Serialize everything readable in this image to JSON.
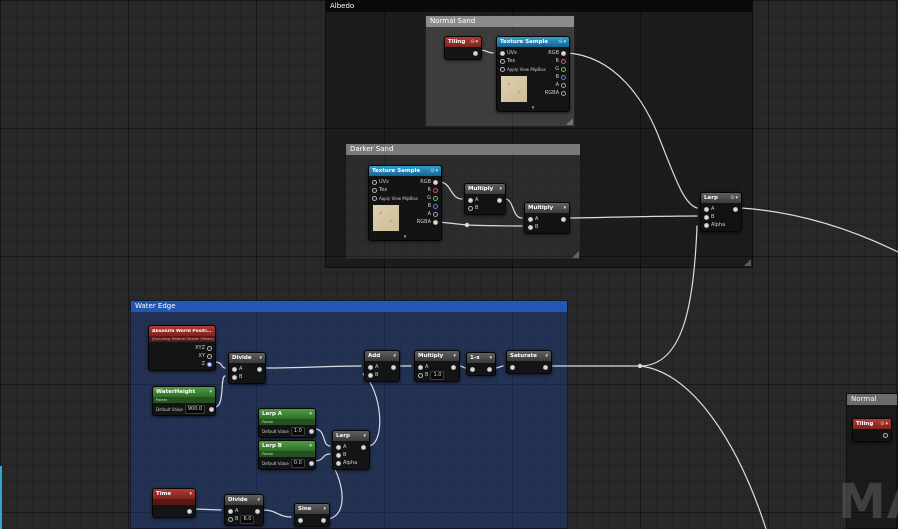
{
  "watermark": "MA",
  "icons": {
    "preview": "⊙",
    "collapse": "▾"
  },
  "comments": {
    "albedo": "Albedo",
    "normal_sand": "Normal Sand",
    "darker_sand": "Darker Sand",
    "water_edge": "Water Edge",
    "normal": "Normal"
  },
  "nodes": {
    "tiling_albedo": {
      "title": "Tiling"
    },
    "tiling_normal": {
      "title": "Tiling"
    },
    "texture_sample_1": {
      "title": "Texture Sample",
      "in": [
        "UVs",
        "Tex",
        "Apply View MipBias"
      ],
      "out": [
        "RGB",
        "R",
        "G",
        "B",
        "A",
        "RGBA"
      ]
    },
    "texture_sample_2": {
      "title": "Texture Sample",
      "in": [
        "UVs",
        "Tex",
        "Apply View MipBias"
      ],
      "out": [
        "RGB",
        "R",
        "G",
        "B",
        "A",
        "RGBA"
      ]
    },
    "multiply_1": {
      "title": "Multiply",
      "in": [
        "A",
        "B"
      ]
    },
    "multiply_2": {
      "title": "Multiply",
      "in": [
        "A",
        "B"
      ]
    },
    "lerp_main": {
      "title": "Lerp",
      "in": [
        "A",
        "B",
        "Alpha"
      ]
    },
    "abs_world_pos": {
      "title": "Absolute World Position",
      "sub": "(Excluding Material Shader Offsets)",
      "out": [
        "XYZ",
        "XY",
        "Z"
      ]
    },
    "divide_1": {
      "title": "Divide",
      "in": [
        "A",
        "B"
      ]
    },
    "water_param": {
      "title": "WaterHeight",
      "sub": "Param",
      "default_label": "Default Value",
      "default_value": "900.0"
    },
    "lerp_a_param": {
      "title": "Lerp A",
      "sub": "Param",
      "default_label": "Default Value",
      "default_value": "1.0"
    },
    "lerp_b_param": {
      "title": "Lerp B",
      "sub": "Param",
      "default_label": "Default Value",
      "default_value": "0.0"
    },
    "lerp_small": {
      "title": "Lerp",
      "in": [
        "A",
        "B",
        "Alpha"
      ]
    },
    "add_1": {
      "title": "Add",
      "in": [
        "A",
        "B"
      ]
    },
    "multiply_3": {
      "title": "Multiply",
      "in": [
        "A",
        "B"
      ],
      "b_value": "1.0"
    },
    "one_minus": {
      "title": "1-x"
    },
    "saturate": {
      "title": "Saturate"
    },
    "time": {
      "title": "Time"
    },
    "divide_2": {
      "title": "Divide",
      "in": [
        "A",
        "B"
      ],
      "b_value": "6.0"
    },
    "sine": {
      "title": "Sine"
    }
  }
}
